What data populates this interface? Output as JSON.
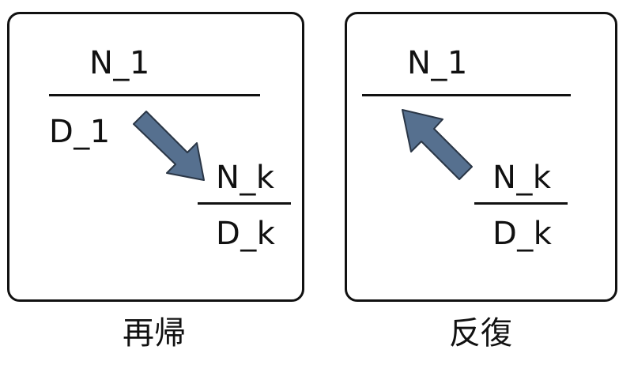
{
  "recursion": {
    "caption": "再帰",
    "outer_numerator": "N_1",
    "outer_denominator": "D_1",
    "inner_numerator": "N_k",
    "inner_denominator": "D_k",
    "arrow_direction": "down-right"
  },
  "iteration": {
    "caption": "反復",
    "outer_numerator": "N_1",
    "inner_numerator": "N_k",
    "inner_denominator": "D_k",
    "arrow_direction": "up-left"
  },
  "colors": {
    "arrow_fill": "#56708f",
    "arrow_stroke": "#2a3646",
    "line": "#111111",
    "background": "#ffffff"
  }
}
